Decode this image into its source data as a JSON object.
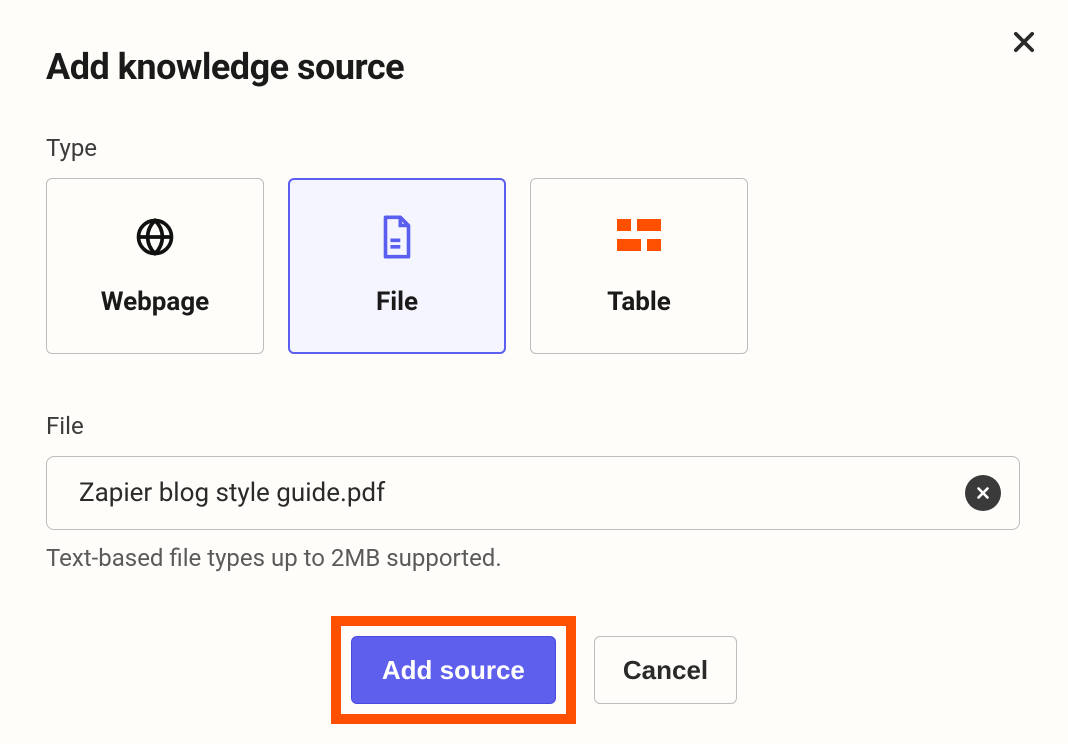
{
  "modal": {
    "title": "Add knowledge source",
    "close_label": "Close"
  },
  "type_section": {
    "label": "Type",
    "options": [
      {
        "id": "webpage",
        "label": "Webpage",
        "icon": "globe-icon",
        "selected": false
      },
      {
        "id": "file",
        "label": "File",
        "icon": "file-icon",
        "selected": true
      },
      {
        "id": "table",
        "label": "Table",
        "icon": "table-icon",
        "selected": false
      }
    ]
  },
  "file_section": {
    "label": "File",
    "filename": "Zapier blog style guide.pdf",
    "clear_label": "Clear file",
    "hint": "Text-based file types up to 2MB supported."
  },
  "actions": {
    "primary_label": "Add source",
    "secondary_label": "Cancel"
  },
  "colors": {
    "accent": "#5b5fef",
    "brand_orange": "#ff4f00"
  }
}
